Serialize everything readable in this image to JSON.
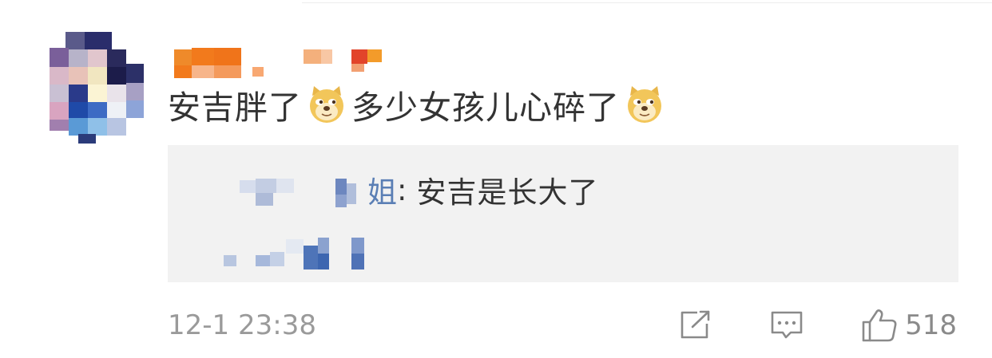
{
  "comment": {
    "text_part1": "安吉胖了",
    "text_part2": "多少女孩儿心碎了",
    "emoji_name": "doge-emoji"
  },
  "reply": {
    "author_tail": "姐",
    "separator": ":",
    "body": "安吉是长大了"
  },
  "footer": {
    "timestamp": "12-1 23:38",
    "like_count": "518",
    "icons": [
      "share-icon",
      "comment-icon",
      "like-icon"
    ]
  },
  "colors": {
    "text": "#333333",
    "link": "#5b7fb5",
    "muted": "#9a9a9a",
    "reply_bg": "#f2f2f2"
  }
}
